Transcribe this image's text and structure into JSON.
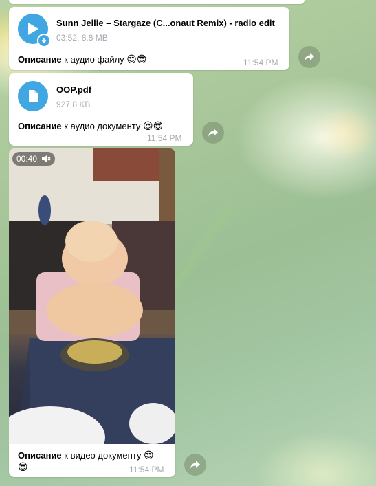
{
  "messages": [
    {
      "kind": "audio",
      "title": "Sunn Jellie – Stargaze (C...onaut Remix) - radio edit",
      "meta": "03:52, 8.8 MB",
      "caption_bold": "Описание",
      "caption_rest": " к аудио файлу ",
      "emoji": "😍😎",
      "time": "11:54 PM"
    },
    {
      "kind": "file",
      "title": "OOP.pdf",
      "meta": "927.8 KB",
      "caption_bold": "Описание",
      "caption_rest": " к аудио документу ",
      "emoji": "😍😎",
      "time": "11:54 PM"
    },
    {
      "kind": "video",
      "duration": "00:40",
      "caption_bold": "Описание",
      "caption_rest": " к видео документу ",
      "emoji1": "😍",
      "emoji2": "😎",
      "time": "11:54 PM"
    }
  ],
  "icons": {
    "play": "play-icon",
    "download": "download-icon",
    "file": "file-icon",
    "share": "share-icon",
    "muted": "muted-speaker-icon"
  },
  "colors": {
    "accent": "#40a7e3",
    "time": "#a5aab0",
    "bubble": "#ffffff"
  }
}
